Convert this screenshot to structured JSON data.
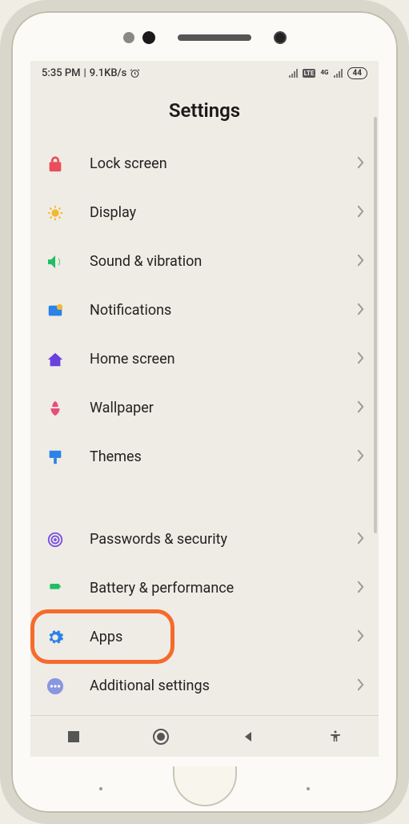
{
  "status_bar": {
    "time": "5:35 PM",
    "separator": " | ",
    "net_speed": "9.1KB/s",
    "battery_level": "44"
  },
  "page_title": "Settings",
  "group1": [
    {
      "id": "lock-screen",
      "label": "Lock screen",
      "icon": "lock-icon",
      "color": "#e94e5a"
    },
    {
      "id": "display",
      "label": "Display",
      "icon": "sun-icon",
      "color": "#f5b82e"
    },
    {
      "id": "sound-vibration",
      "label": "Sound & vibration",
      "icon": "volume-icon",
      "color": "#1fbf62"
    },
    {
      "id": "notifications",
      "label": "Notifications",
      "icon": "notification-icon",
      "color": "#2b82e8"
    },
    {
      "id": "home-screen",
      "label": "Home screen",
      "icon": "home-icon",
      "color": "#6a3fe0"
    },
    {
      "id": "wallpaper",
      "label": "Wallpaper",
      "icon": "flower-icon",
      "color": "#e84e7a"
    },
    {
      "id": "themes",
      "label": "Themes",
      "icon": "brush-icon",
      "color": "#2b82e8"
    }
  ],
  "group2": [
    {
      "id": "passwords-security",
      "label": "Passwords & security",
      "icon": "shield-icon",
      "color": "#7a4fe0"
    },
    {
      "id": "battery-performance",
      "label": "Battery & performance",
      "icon": "battery-icon",
      "color": "#1fbf62"
    },
    {
      "id": "apps",
      "label": "Apps",
      "icon": "gear-icon",
      "color": "#2b82e8",
      "highlighted": true
    },
    {
      "id": "additional-settings",
      "label": "Additional settings",
      "icon": "dots-icon",
      "color": "#8a96e0"
    }
  ]
}
